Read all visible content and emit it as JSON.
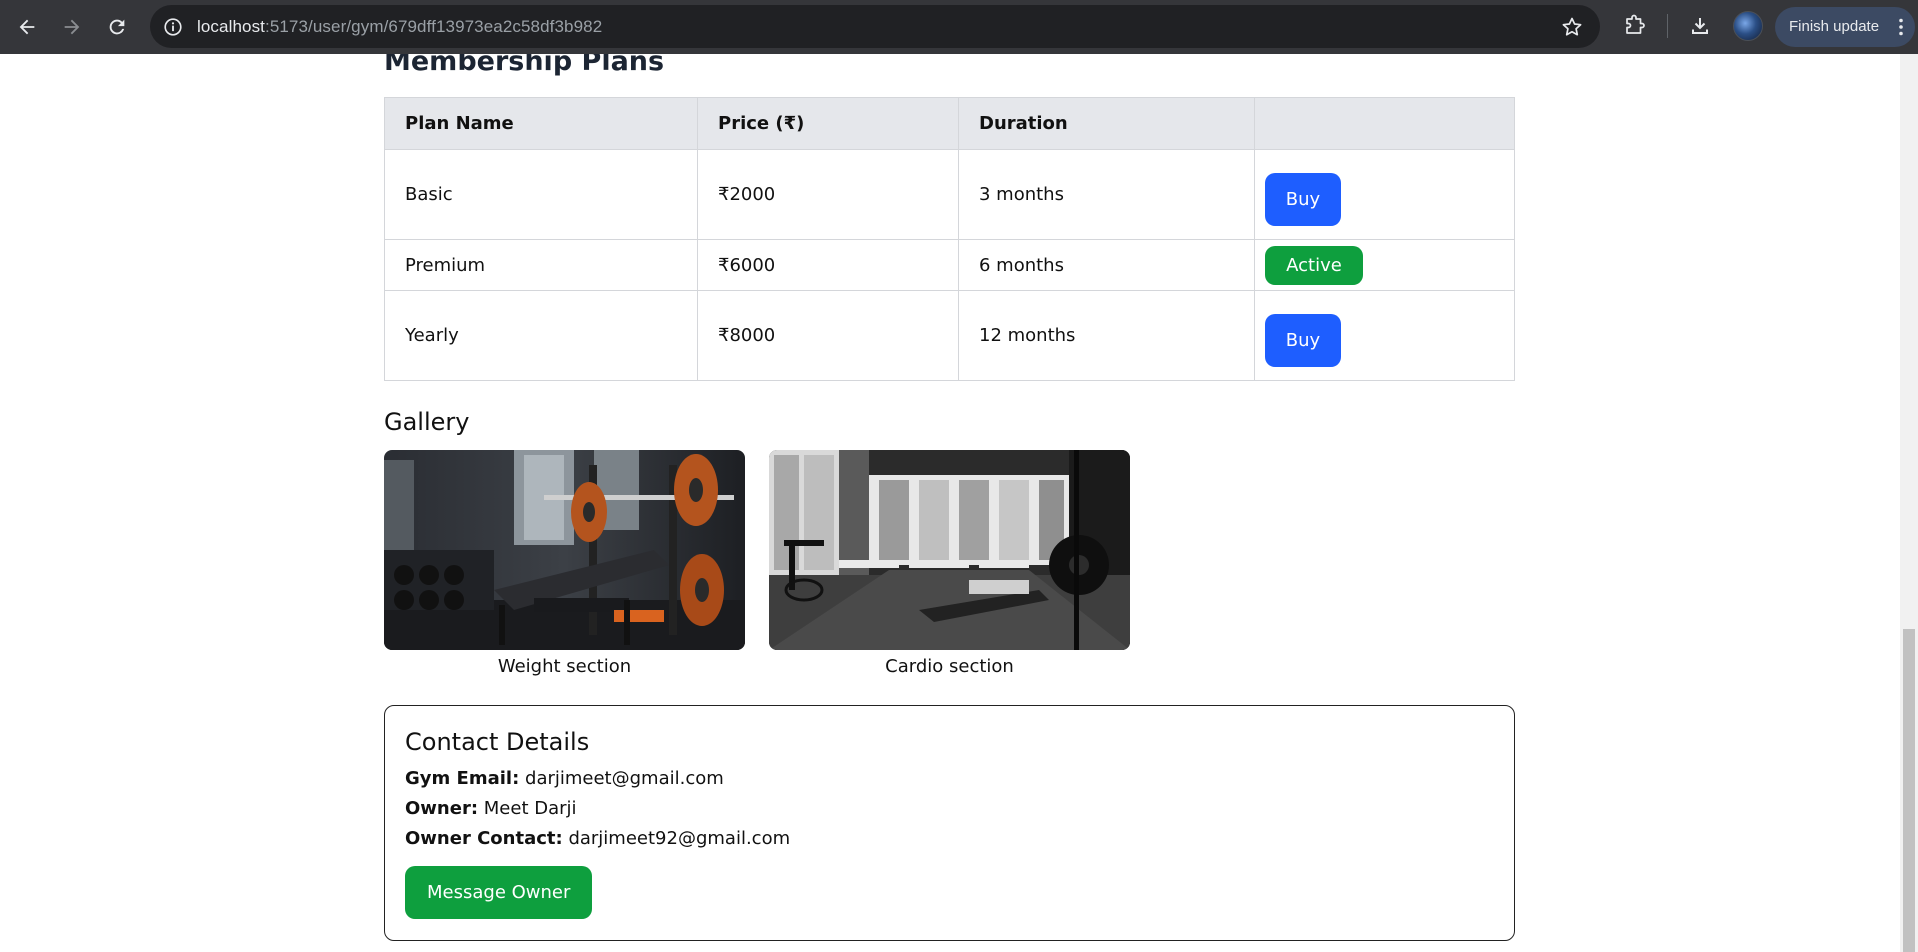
{
  "browser": {
    "url_host": "localhost",
    "url_path": ":5173/user/gym/679dff13973ea2c58df3b982",
    "update_label": "Finish update",
    "icons": [
      "back-arrow-icon",
      "forward-arrow-icon",
      "reload-icon",
      "site-info-icon",
      "bookmark-star-icon",
      "extensions-icon",
      "download-icon",
      "profile-avatar",
      "more-vert-icon"
    ]
  },
  "membership": {
    "title": "Membership Plans",
    "headers": [
      "Plan Name",
      "Price (₹)",
      "Duration",
      ""
    ],
    "plans": [
      {
        "name": "Basic",
        "price": "₹2000",
        "duration": "3 months",
        "action": "Buy"
      },
      {
        "name": "Premium",
        "price": "₹6000",
        "duration": "6 months",
        "action": "Active"
      },
      {
        "name": "Yearly",
        "price": "₹8000",
        "duration": "12 months",
        "action": "Buy"
      }
    ]
  },
  "gallery": {
    "title": "Gallery",
    "items": [
      {
        "caption": "Weight section"
      },
      {
        "caption": "Cardio section"
      }
    ]
  },
  "contact": {
    "title": "Contact Details",
    "email_label": "Gym Email:",
    "email": "darjimeet@gmail.com",
    "owner_label": "Owner:",
    "owner": "Meet Darji",
    "owner_contact_label": "Owner Contact:",
    "owner_contact": "darjimeet92@gmail.com",
    "message_button": "Message Owner"
  },
  "colors": {
    "buy_button": "#1e5eff",
    "active_badge": "#0e9f3e",
    "message_button": "#0e9f3e",
    "table_header_bg": "#e5e7eb"
  }
}
